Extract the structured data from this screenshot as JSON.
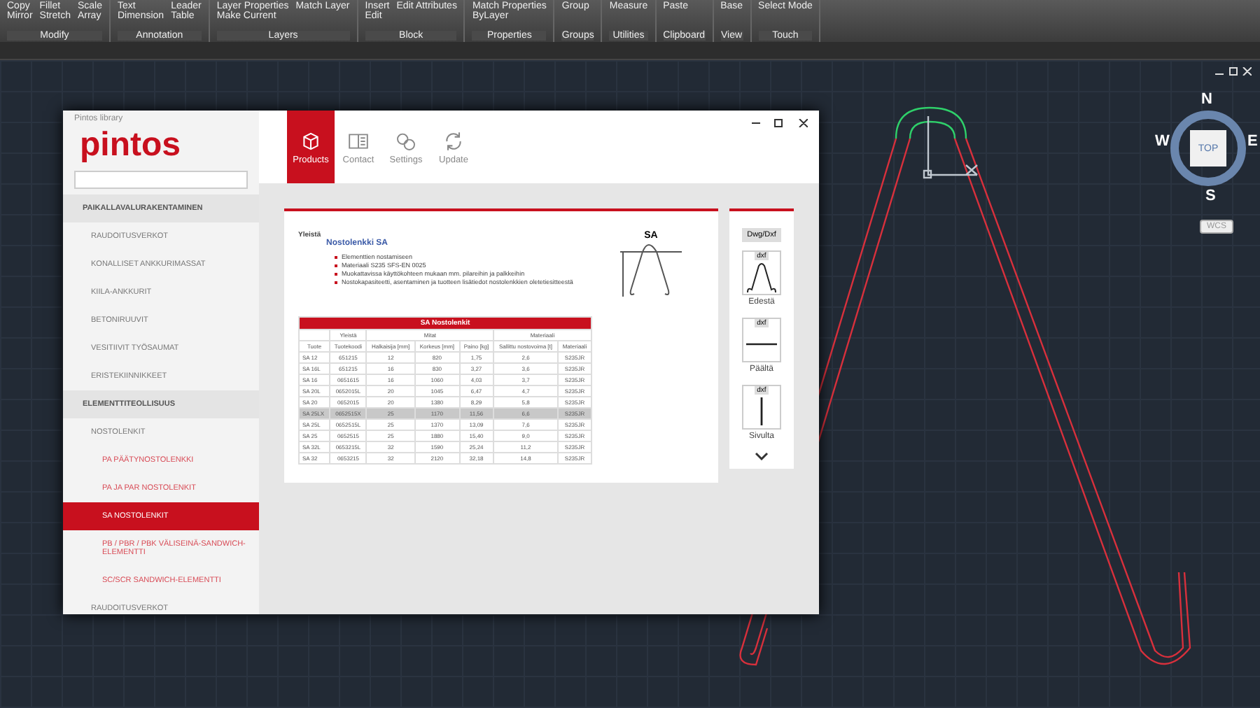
{
  "ribbon": {
    "panels": [
      {
        "label": "Modify",
        "buttons": [
          "Copy",
          "Mirror",
          "Fillet",
          "Stretch",
          "Scale",
          "Array"
        ]
      },
      {
        "label": "Annotation",
        "buttons": [
          "Text",
          "Dimension",
          "Leader",
          "Table"
        ]
      },
      {
        "label": "Layers",
        "buttons": [
          "Layer Properties",
          "Make Current",
          "Match Layer"
        ]
      },
      {
        "label": "Block",
        "buttons": [
          "Insert",
          "Edit",
          "Edit Attributes"
        ]
      },
      {
        "label": "Properties",
        "buttons": [
          "Match Properties",
          "ByLayer"
        ]
      },
      {
        "label": "Groups",
        "buttons": [
          "Group"
        ]
      },
      {
        "label": "Utilities",
        "buttons": [
          "Measure"
        ]
      },
      {
        "label": "Clipboard",
        "buttons": [
          "Paste"
        ]
      },
      {
        "label": "View",
        "buttons": [
          "Base"
        ]
      },
      {
        "label": "Touch",
        "buttons": [
          "Select Mode"
        ]
      }
    ]
  },
  "app": {
    "title": "Pintos library",
    "logo": "pintos",
    "nav": [
      {
        "label": "Products",
        "selected": true
      },
      {
        "label": "Contact",
        "selected": false
      },
      {
        "label": "Settings",
        "selected": false
      },
      {
        "label": "Update",
        "selected": false
      }
    ],
    "sidebar": [
      {
        "label": "PAIKALLAVALURAKENTAMINEN",
        "selected": false,
        "children": [
          {
            "label": "RAUDOITUSVERKOT",
            "selected": false
          },
          {
            "label": "KONALLISET ANKKURIMASSAT",
            "selected": false
          },
          {
            "label": "KIILA-ANKKURIT",
            "selected": false
          },
          {
            "label": "BETONIRUUVIT",
            "selected": false
          },
          {
            "label": "VESITIIVIT TYÖSAUMAT",
            "selected": false
          },
          {
            "label": "ERISTEKIINNIKKEET",
            "selected": false
          }
        ]
      },
      {
        "label": "ELEMENTTITEOLLISUUS",
        "selected": false,
        "children": [
          {
            "label": "NOSTOLENKIT",
            "selected": false,
            "children": [
              {
                "label": "PA PÄÄTYNOSTOLENKKI",
                "selected": false
              },
              {
                "label": "PA JA PAR NOSTOLENKIT",
                "selected": false
              },
              {
                "label": "SA NOSTOLENKIT",
                "selected": true
              },
              {
                "label": "PB / PBR / PBK VÄLISEINÄ-SANDWICH-ELEMENTTI",
                "selected": false
              },
              {
                "label": "SC/SCR SANDWICH-ELEMENTTI",
                "selected": false
              }
            ]
          },
          {
            "label": "RAUDOITUSVERKOT",
            "selected": false
          }
        ]
      }
    ],
    "document": {
      "section": "Yleistä",
      "heading": "Nostolenkki SA",
      "bullets": [
        "Elementtien nostamiseen",
        "Materiaali S235 SFS-EN 0025",
        "Muokattavissa käyttökohteen mukaan mm. pilareihin ja palkkeihin",
        "Nostokapasiteetti, asentaminen ja tuotteen lisätiedot nostolenkkien oletetiesitteestä"
      ],
      "figure_label": "SA",
      "table": {
        "title": "SA Nostolenkit",
        "groups": [
          {
            "label": "Yleistä"
          },
          {
            "label": "Mitat"
          },
          {
            "label": "Materiaali"
          }
        ],
        "columns": [
          "Tuote",
          "Tuotekoodi",
          "Halkaisija [mm]",
          "Korkeus [mm]",
          "Paino [kg]",
          "Sallittu nostovoima [t]",
          "Materiaali"
        ],
        "rows": [
          {
            "cells": [
              "SA 12",
              "651215",
              "12",
              "820",
              "1,75",
              "2,6",
              "S235JR"
            ],
            "selected": false
          },
          {
            "cells": [
              "SA 16L",
              "651215",
              "16",
              "830",
              "3,27",
              "3,6",
              "S235JR"
            ],
            "selected": false
          },
          {
            "cells": [
              "SA 16",
              "0651615",
              "16",
              "1060",
              "4,03",
              "3,7",
              "S235JR"
            ],
            "selected": false
          },
          {
            "cells": [
              "SA 20L",
              "0652015L",
              "20",
              "1045",
              "6,47",
              "4,7",
              "S235JR"
            ],
            "selected": false
          },
          {
            "cells": [
              "SA 20",
              "0652015",
              "20",
              "1380",
              "8,29",
              "5,8",
              "S235JR"
            ],
            "selected": false
          },
          {
            "cells": [
              "SA 25LX",
              "0652515X",
              "25",
              "1170",
              "11,56",
              "6,6",
              "S235JR"
            ],
            "selected": true
          },
          {
            "cells": [
              "SA 25L",
              "0652515L",
              "25",
              "1370",
              "13,09",
              "7,6",
              "S235JR"
            ],
            "selected": false
          },
          {
            "cells": [
              "SA 25",
              "0652515",
              "25",
              "1880",
              "15,40",
              "9,0",
              "S235JR"
            ],
            "selected": false
          },
          {
            "cells": [
              "SA 32L",
              "0653215L",
              "32",
              "1590",
              "25,24",
              "11,2",
              "S235JR"
            ],
            "selected": false
          },
          {
            "cells": [
              "SA 32",
              "0653215",
              "32",
              "2120",
              "32,18",
              "14,8",
              "S235JR"
            ],
            "selected": false
          }
        ]
      }
    },
    "downloads": {
      "format": "Dwg/Dxf",
      "views": [
        {
          "badge": "dxf",
          "label": "Edestä",
          "kind": "front"
        },
        {
          "badge": "dxf",
          "label": "Päältä",
          "kind": "top"
        },
        {
          "badge": "dxf",
          "label": "Sivulta",
          "kind": "side"
        }
      ]
    }
  },
  "viewcube": {
    "north": "N",
    "west": "W",
    "east": "E",
    "south": "S",
    "face": "TOP",
    "ucs": "WCS"
  }
}
